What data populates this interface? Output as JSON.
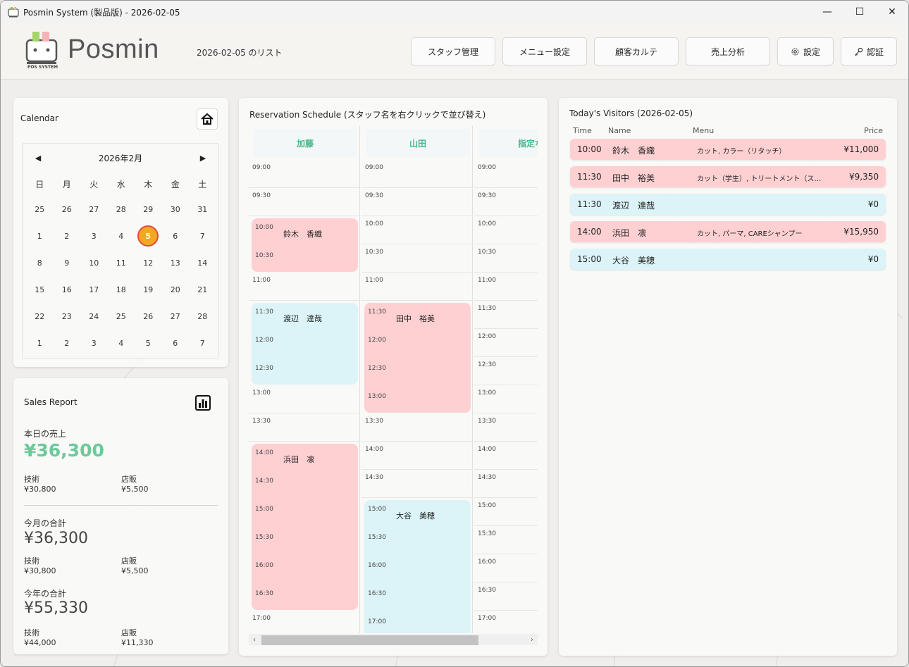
{
  "window": {
    "title": "Posmin System (製品版) - 2026-02-05",
    "minimize": "—",
    "maximize": "☐",
    "close": "✕"
  },
  "header": {
    "logo_text": "Posmin",
    "logo_sub": "POS SYSTEM",
    "list_date": "2026-02-05 のリスト",
    "nav": {
      "staff": "スタッフ管理",
      "menu": "メニュー設定",
      "customer": "顧客カルテ",
      "sales": "売上分析",
      "settings": "設定",
      "auth": "認証"
    }
  },
  "calendar": {
    "title": "Calendar",
    "month_label": "2026年2月",
    "prev": "◀",
    "next": "▶",
    "weekdays": [
      "日",
      "月",
      "火",
      "水",
      "木",
      "金",
      "土"
    ],
    "weeks": [
      [
        "25",
        "26",
        "27",
        "28",
        "29",
        "30",
        "31"
      ],
      [
        "1",
        "2",
        "3",
        "4",
        "5",
        "6",
        "7"
      ],
      [
        "8",
        "9",
        "10",
        "11",
        "12",
        "13",
        "14"
      ],
      [
        "15",
        "16",
        "17",
        "18",
        "19",
        "20",
        "21"
      ],
      [
        "22",
        "23",
        "24",
        "25",
        "26",
        "27",
        "28"
      ],
      [
        "1",
        "2",
        "3",
        "4",
        "5",
        "6",
        "7"
      ]
    ],
    "today": "5"
  },
  "sales": {
    "title": "Sales Report",
    "today_label": "本日の売上",
    "today_total": "¥36,300",
    "today_tech_label": "技術",
    "today_tech": "¥30,800",
    "today_retail_label": "店販",
    "today_retail": "¥5,500",
    "month_label": "今月の合計",
    "month_total": "¥36,300",
    "month_tech_label": "技術",
    "month_tech": "¥30,800",
    "month_retail_label": "店販",
    "month_retail": "¥5,500",
    "year_label": "今年の合計",
    "year_total": "¥55,330",
    "year_tech_label": "技術",
    "year_tech": "¥44,000",
    "year_retail_label": "店販",
    "year_retail": "¥11,330"
  },
  "schedule": {
    "title": "Reservation Schedule (スタッフ名を右クリックで並び替え)",
    "staff": [
      {
        "name": "加藤",
        "slots": [
          "09:00",
          "09:30",
          "11:00",
          "13:00",
          "13:30",
          "17:00"
        ],
        "appointments": [
          {
            "client": "鈴木　香織",
            "times": [
              "10:00",
              "10:30"
            ],
            "color": "pink"
          },
          {
            "client": "渡辺　達哉",
            "times": [
              "11:30",
              "12:00",
              "12:30"
            ],
            "color": "cyan"
          },
          {
            "client": "浜田　凛",
            "times": [
              "14:00",
              "14:30",
              "15:00",
              "15:30",
              "16:00",
              "16:30"
            ],
            "color": "pink"
          }
        ]
      },
      {
        "name": "山田",
        "slots": [
          "09:00",
          "09:30",
          "10:00",
          "10:30",
          "11:00",
          "13:30",
          "14:00",
          "14:30"
        ],
        "appointments": [
          {
            "client": "田中　裕美",
            "times": [
              "11:30",
              "12:00",
              "12:30",
              "13:00"
            ],
            "color": "pink"
          },
          {
            "client": "大谷　美穂",
            "times": [
              "15:00",
              "15:30",
              "16:00",
              "16:30",
              "17:00"
            ],
            "color": "cyan"
          }
        ]
      },
      {
        "name": "指定な",
        "slots": [
          "09:00",
          "09:30",
          "10:00",
          "10:30",
          "11:00",
          "11:30",
          "12:00",
          "12:30",
          "13:00",
          "13:30",
          "14:00",
          "14:30",
          "15:00",
          "15:30",
          "16:00",
          "16:30",
          "17:00"
        ],
        "appointments": []
      }
    ],
    "scroll_left": "‹",
    "scroll_right": "›"
  },
  "visitors": {
    "title": "Today's Visitors (2026-02-05)",
    "columns": {
      "time": "Time",
      "name": "Name",
      "menu": "Menu",
      "price": "Price"
    },
    "rows": [
      {
        "time": "10:00",
        "name": "鈴木　香織",
        "menu": "カット, カラー（リタッチ）",
        "price": "¥11,000",
        "color": "pink"
      },
      {
        "time": "11:30",
        "name": "田中　裕美",
        "menu": "カット（学生）, トリートメント（スタンダー...",
        "price": "¥9,350",
        "color": "pink"
      },
      {
        "time": "11:30",
        "name": "渡辺　達哉",
        "menu": "",
        "price": "¥0",
        "color": "cyan"
      },
      {
        "time": "14:00",
        "name": "浜田　凛",
        "menu": "カット, パーマ, CAREシャンプー",
        "price": "¥15,950",
        "color": "pink"
      },
      {
        "time": "15:00",
        "name": "大谷　美穂",
        "menu": "",
        "price": "¥0",
        "color": "cyan"
      }
    ]
  },
  "colors": {
    "accent_green": "#6cc99a",
    "staff_green": "#4bb58a",
    "appt_pink": "#ffd0d2",
    "appt_cyan": "#dcf4f7",
    "today_orange": "#f5a623"
  }
}
